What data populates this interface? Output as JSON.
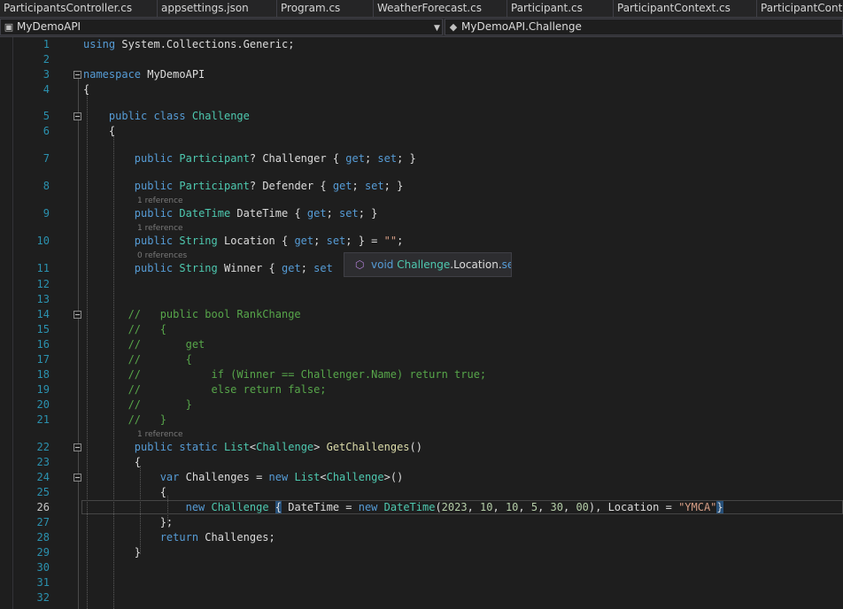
{
  "tabs": [
    {
      "label": "ParticipantsController.cs"
    },
    {
      "label": "appsettings.json"
    },
    {
      "label": "Program.cs"
    },
    {
      "label": "WeatherForecast.cs"
    },
    {
      "label": "Participant.cs"
    },
    {
      "label": "ParticipantContext.cs"
    },
    {
      "label": "ParticipantContro"
    }
  ],
  "navbar": {
    "project": "MyDemoAPI",
    "project_icon": "csharp-project-icon",
    "member": "MyDemoAPI.Challenge",
    "member_icon": "class-icon"
  },
  "editor": {
    "current_line": 26,
    "line_numbers": [
      "1",
      "2",
      "3",
      "4",
      "5",
      "6",
      "7",
      "8",
      "9",
      "10",
      "11",
      "12",
      "13",
      "14",
      "15",
      "16",
      "17",
      "18",
      "19",
      "20",
      "21",
      "22",
      "23",
      "24",
      "25",
      "26",
      "27",
      "28",
      "29",
      "30",
      "31",
      "32"
    ],
    "code_lines": [
      [
        {
          "t": "kw",
          "v": "using"
        },
        {
          "t": "id",
          "v": " System.Collections.Generic;"
        }
      ],
      [],
      [
        {
          "t": "kw",
          "v": "namespace"
        },
        {
          "t": "id",
          "v": " MyDemoAPI"
        }
      ],
      [
        {
          "t": "pr",
          "v": "{"
        }
      ],
      [
        {
          "t": "id",
          "v": "    "
        },
        {
          "t": "kw",
          "v": "public"
        },
        {
          "t": "id",
          "v": " "
        },
        {
          "t": "kw",
          "v": "class"
        },
        {
          "t": "id",
          "v": " "
        },
        {
          "t": "ty",
          "v": "Challenge"
        }
      ],
      [
        {
          "t": "pr",
          "v": "    {"
        }
      ],
      [
        {
          "t": "id",
          "v": "        "
        },
        {
          "t": "kw",
          "v": "public"
        },
        {
          "t": "id",
          "v": " "
        },
        {
          "t": "ty",
          "v": "Participant"
        },
        {
          "t": "pr",
          "v": "?"
        },
        {
          "t": "id",
          "v": " Challenger "
        },
        {
          "t": "pr",
          "v": "{ "
        },
        {
          "t": "kw",
          "v": "get"
        },
        {
          "t": "pr",
          "v": "; "
        },
        {
          "t": "kw",
          "v": "set"
        },
        {
          "t": "pr",
          "v": "; }"
        }
      ],
      [
        {
          "t": "id",
          "v": "        "
        },
        {
          "t": "kw",
          "v": "public"
        },
        {
          "t": "id",
          "v": " "
        },
        {
          "t": "ty",
          "v": "Participant"
        },
        {
          "t": "pr",
          "v": "?"
        },
        {
          "t": "id",
          "v": " Defender "
        },
        {
          "t": "pr",
          "v": "{ "
        },
        {
          "t": "kw",
          "v": "get"
        },
        {
          "t": "pr",
          "v": "; "
        },
        {
          "t": "kw",
          "v": "set"
        },
        {
          "t": "pr",
          "v": "; }"
        }
      ],
      [
        {
          "t": "id",
          "v": "        "
        },
        {
          "t": "kw",
          "v": "public"
        },
        {
          "t": "id",
          "v": " "
        },
        {
          "t": "ty",
          "v": "DateTime"
        },
        {
          "t": "id",
          "v": " DateTime "
        },
        {
          "t": "pr",
          "v": "{ "
        },
        {
          "t": "kw",
          "v": "get"
        },
        {
          "t": "pr",
          "v": "; "
        },
        {
          "t": "kw",
          "v": "set"
        },
        {
          "t": "pr",
          "v": "; }"
        }
      ],
      [
        {
          "t": "id",
          "v": "        "
        },
        {
          "t": "kw",
          "v": "public"
        },
        {
          "t": "id",
          "v": " "
        },
        {
          "t": "ty",
          "v": "String"
        },
        {
          "t": "id",
          "v": " Location "
        },
        {
          "t": "pr",
          "v": "{ "
        },
        {
          "t": "kw",
          "v": "get"
        },
        {
          "t": "pr",
          "v": "; "
        },
        {
          "t": "kw",
          "v": "set"
        },
        {
          "t": "pr",
          "v": "; } = "
        },
        {
          "t": "st",
          "v": "\"\""
        },
        {
          "t": "pr",
          "v": ";"
        }
      ],
      [
        {
          "t": "id",
          "v": "        "
        },
        {
          "t": "kw",
          "v": "public"
        },
        {
          "t": "id",
          "v": " "
        },
        {
          "t": "ty",
          "v": "String"
        },
        {
          "t": "id",
          "v": " Winner "
        },
        {
          "t": "pr",
          "v": "{ "
        },
        {
          "t": "kw",
          "v": "get"
        },
        {
          "t": "pr",
          "v": "; "
        },
        {
          "t": "kw",
          "v": "set"
        }
      ],
      [],
      [],
      [
        {
          "t": "cm",
          "v": "       //   public bool RankChange"
        }
      ],
      [
        {
          "t": "cm",
          "v": "       //   {"
        }
      ],
      [
        {
          "t": "cm",
          "v": "       //       get"
        }
      ],
      [
        {
          "t": "cm",
          "v": "       //       {"
        }
      ],
      [
        {
          "t": "cm",
          "v": "       //           if (Winner == Challenger.Name) return true;"
        }
      ],
      [
        {
          "t": "cm",
          "v": "       //           else return false;"
        }
      ],
      [
        {
          "t": "cm",
          "v": "       //       }"
        }
      ],
      [
        {
          "t": "cm",
          "v": "       //   }"
        }
      ],
      [
        {
          "t": "id",
          "v": "        "
        },
        {
          "t": "kw",
          "v": "public"
        },
        {
          "t": "id",
          "v": " "
        },
        {
          "t": "kw",
          "v": "static"
        },
        {
          "t": "id",
          "v": " "
        },
        {
          "t": "ty",
          "v": "List"
        },
        {
          "t": "pr",
          "v": "<"
        },
        {
          "t": "ty",
          "v": "Challenge"
        },
        {
          "t": "pr",
          "v": "> "
        },
        {
          "t": "me",
          "v": "GetChallenges"
        },
        {
          "t": "pr",
          "v": "()"
        }
      ],
      [
        {
          "t": "pr",
          "v": "        {"
        }
      ],
      [
        {
          "t": "id",
          "v": "            "
        },
        {
          "t": "kw",
          "v": "var"
        },
        {
          "t": "id",
          "v": " Challenges "
        },
        {
          "t": "pr",
          "v": "= "
        },
        {
          "t": "kw",
          "v": "new"
        },
        {
          "t": "id",
          "v": " "
        },
        {
          "t": "ty",
          "v": "List"
        },
        {
          "t": "pr",
          "v": "<"
        },
        {
          "t": "ty",
          "v": "Challenge"
        },
        {
          "t": "pr",
          "v": ">()"
        }
      ],
      [
        {
          "t": "pr",
          "v": "            {"
        }
      ],
      [
        {
          "t": "id",
          "v": "                "
        },
        {
          "t": "kw",
          "v": "new"
        },
        {
          "t": "id",
          "v": " "
        },
        {
          "t": "ty",
          "v": "Challenge"
        },
        {
          "t": "id",
          "v": " "
        },
        {
          "t": "hl",
          "v": "{"
        },
        {
          "t": "id",
          "v": " DateTime "
        },
        {
          "t": "pr",
          "v": "= "
        },
        {
          "t": "kw",
          "v": "new"
        },
        {
          "t": "id",
          "v": " "
        },
        {
          "t": "ty",
          "v": "DateTime"
        },
        {
          "t": "pr",
          "v": "("
        },
        {
          "t": "nu",
          "v": "2023"
        },
        {
          "t": "pr",
          "v": ", "
        },
        {
          "t": "nu",
          "v": "10"
        },
        {
          "t": "pr",
          "v": ", "
        },
        {
          "t": "nu",
          "v": "10"
        },
        {
          "t": "pr",
          "v": ", "
        },
        {
          "t": "nu",
          "v": "5"
        },
        {
          "t": "pr",
          "v": ", "
        },
        {
          "t": "nu",
          "v": "30"
        },
        {
          "t": "pr",
          "v": ", "
        },
        {
          "t": "nu",
          "v": "00"
        },
        {
          "t": "pr",
          "v": "), "
        },
        {
          "t": "id",
          "v": "Location "
        },
        {
          "t": "pr",
          "v": "= "
        },
        {
          "t": "st",
          "v": "\"YMCA\""
        },
        {
          "t": "hl",
          "v": "}"
        }
      ],
      [
        {
          "t": "pr",
          "v": "            };"
        }
      ],
      [
        {
          "t": "id",
          "v": "            "
        },
        {
          "t": "kw",
          "v": "return"
        },
        {
          "t": "id",
          "v": " Challenges;"
        }
      ],
      [
        {
          "t": "pr",
          "v": "        }"
        }
      ],
      [],
      [],
      []
    ],
    "code_lens": [
      {
        "line": 9,
        "text": "1 reference"
      },
      {
        "line": 10,
        "text": "1 reference"
      },
      {
        "line": 11,
        "text": "0 references"
      },
      {
        "line": 22,
        "text": "1 reference"
      }
    ]
  },
  "tooltip": {
    "icon": "property-icon",
    "keyword": "void",
    "type": "Challenge",
    "dot1": ".",
    "member": "Location",
    "dot2": ".",
    "accessor": "set"
  }
}
